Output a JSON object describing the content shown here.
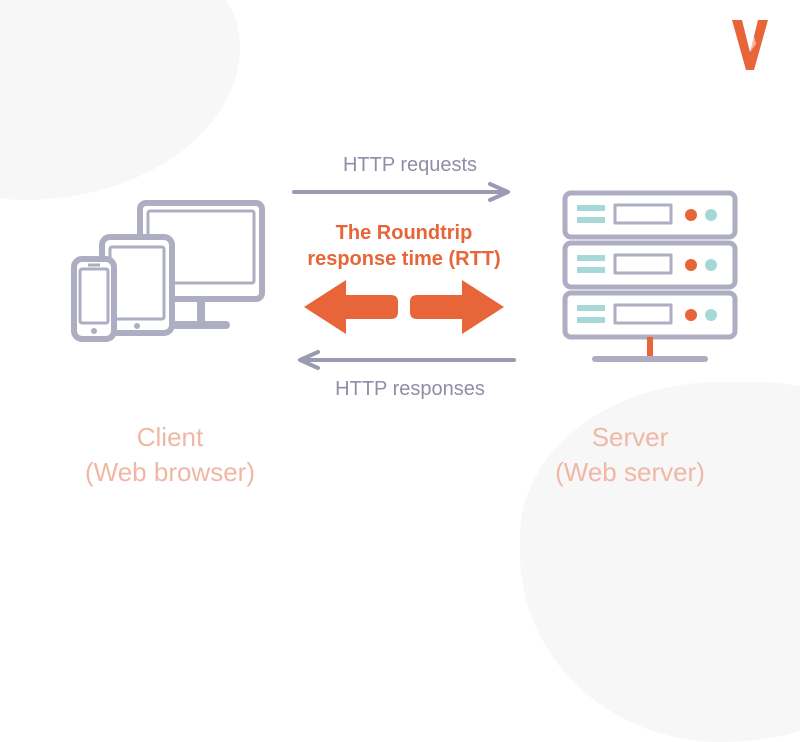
{
  "logo": {
    "alt": "logo-w"
  },
  "labels": {
    "request": "HTTP requests",
    "response": "HTTP responses",
    "rtt_line1": "The Roundtrip",
    "rtt_line2": "response time (RTT)"
  },
  "captions": {
    "client_line1": "Client",
    "client_line2": "(Web browser)",
    "server_line1": "Server",
    "server_line2": "(Web server)"
  },
  "colors": {
    "accent": "#e76538",
    "muted_line": "#9a9ab0",
    "muted_text": "#8e8ea8",
    "caption": "#f0b8a4",
    "teal": "#a6d8d8"
  }
}
